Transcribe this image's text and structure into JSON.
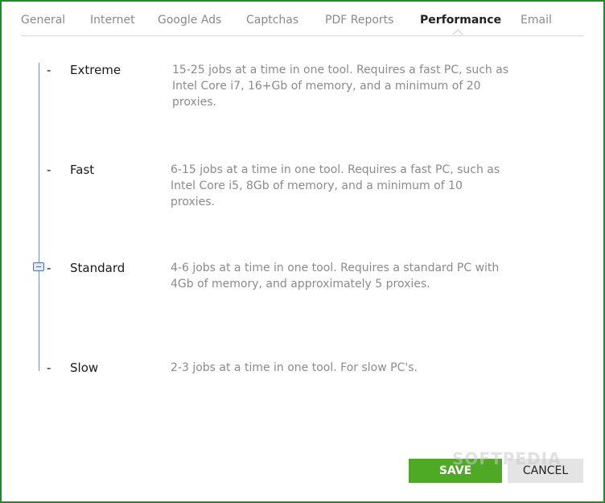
{
  "tabs": [
    {
      "label": "General"
    },
    {
      "label": "Internet"
    },
    {
      "label": "Google Ads"
    },
    {
      "label": "Captchas"
    },
    {
      "label": "PDF Reports"
    },
    {
      "label": "Performance",
      "active": true
    },
    {
      "label": "Email"
    }
  ],
  "performance": {
    "tick_mark": "-",
    "selected_level": "Standard",
    "levels": [
      {
        "name": "Extreme",
        "description": "15-25 jobs at a time in one tool. Requires a fast PC, such as Intel Core i7, 16+Gb of memory, and a minimum of 20 proxies."
      },
      {
        "name": "Fast",
        "description": "6-15 jobs at a time in one tool. Requires a fast PC, such as Intel Core i5, 8Gb of memory, and a minimum of 10 proxies."
      },
      {
        "name": "Standard",
        "description": "4-6 jobs at a time in one tool. Requires a standard PC with 4Gb of memory, and approximately 5 proxies."
      },
      {
        "name": "Slow",
        "description": "2-3 jobs at a time in one tool. For slow PC's."
      }
    ]
  },
  "buttons": {
    "save_label": "SAVE",
    "cancel_label": "CANCEL"
  },
  "watermark": "SOFTPEDIA",
  "colors": {
    "frame_border": "#1f8a2e",
    "save_bg": "#4ea924",
    "cancel_bg": "#e4e4e4",
    "slider_track": "#6f8fd1"
  }
}
